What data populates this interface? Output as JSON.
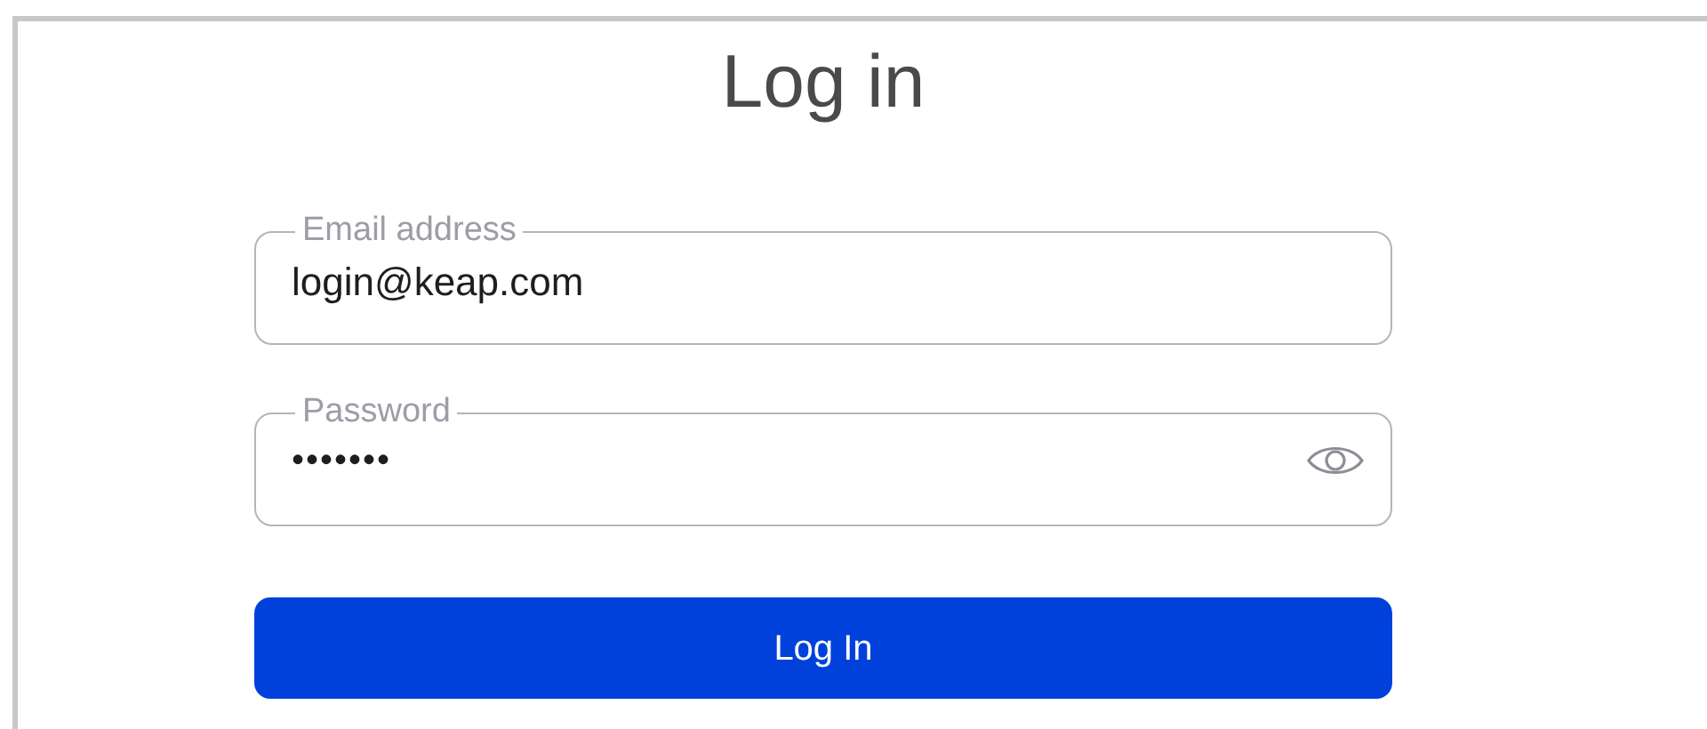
{
  "title": "Log in",
  "fields": [
    {
      "label": "Email address",
      "value": "login@keap.com",
      "kind": "text"
    },
    {
      "label": "Password",
      "value": "•••••••",
      "kind": "password"
    }
  ],
  "button": "Log In"
}
